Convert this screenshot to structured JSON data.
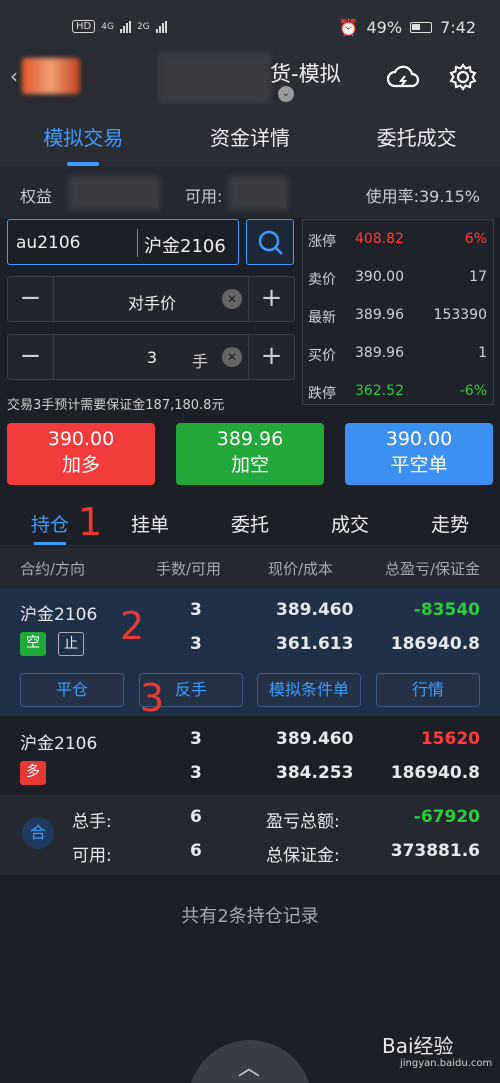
{
  "status": {
    "hd": "HD",
    "net1": "4G",
    "net2": "2G",
    "battery": "49%",
    "time": "7:42"
  },
  "header": {
    "title": "货-模拟"
  },
  "top_tabs": [
    "模拟交易",
    "资金详情",
    "委托成交"
  ],
  "summary": {
    "equity_label": "权益",
    "available_label": "可用:",
    "usage": "使用率:39.15%"
  },
  "order": {
    "code": "au2106",
    "name": "沪金2106",
    "price_type": "对手价",
    "quantity": "3",
    "quantity_unit": "手",
    "margin_note": "交易3手预计需要保证金187,180.8元"
  },
  "quotes": [
    {
      "label": "涨停",
      "price": "408.82",
      "right": "6%",
      "color": "#ff3b3b",
      "rcolor": "#ff3b3b"
    },
    {
      "label": "卖价",
      "price": "390.00",
      "right": "17",
      "color": "#cfd2d6",
      "rcolor": "#cfd2d6"
    },
    {
      "label": "最新",
      "price": "389.96",
      "right": "153390",
      "color": "#cfd2d6",
      "rcolor": "#cfd2d6"
    },
    {
      "label": "买价",
      "price": "389.96",
      "right": "1",
      "color": "#cfd2d6",
      "rcolor": "#cfd2d6"
    },
    {
      "label": "跌停",
      "price": "362.52",
      "right": "-6%",
      "color": "#2ecc40",
      "rcolor": "#2ecc40"
    }
  ],
  "actions": [
    {
      "price": "390.00",
      "label": "加多",
      "color": "#f23c3c"
    },
    {
      "price": "389.96",
      "label": "加空",
      "color": "#22a83a"
    },
    {
      "price": "390.00",
      "label": "平空单",
      "color": "#3d8ff0"
    }
  ],
  "pos_tabs": [
    "持仓",
    "挂单",
    "委托",
    "成交",
    "走势"
  ],
  "columns": [
    "合约/方向",
    "手数/可用",
    "现价/成本",
    "总盈亏/保证金"
  ],
  "positions": [
    {
      "name": "沪金2106",
      "direction": "空",
      "stop": "止",
      "lots": "3",
      "avail": "3",
      "price": "389.460",
      "cost": "361.613",
      "pnl": "-83540",
      "margin": "186940.8"
    },
    {
      "name": "沪金2106",
      "direction": "多",
      "lots": "3",
      "avail": "3",
      "price": "389.460",
      "cost": "384.253",
      "pnl": "15620",
      "margin": "186940.8"
    }
  ],
  "row_actions": [
    "平仓",
    "反手",
    "模拟条件单",
    "行情"
  ],
  "annotations": [
    "1",
    "2",
    "3"
  ],
  "totals": {
    "badge": "合",
    "total_lots_label": "总手:",
    "total_lots": "6",
    "avail_label": "可用:",
    "avail": "6",
    "pnl_label": "盈亏总额:",
    "pnl": "-67920",
    "margin_label": "总保证金:",
    "margin": "373881.6"
  },
  "record_count": "共有2条持仓记录",
  "watermark": {
    "main": "Bai经验",
    "sub": "jingyan.baidu.com"
  }
}
